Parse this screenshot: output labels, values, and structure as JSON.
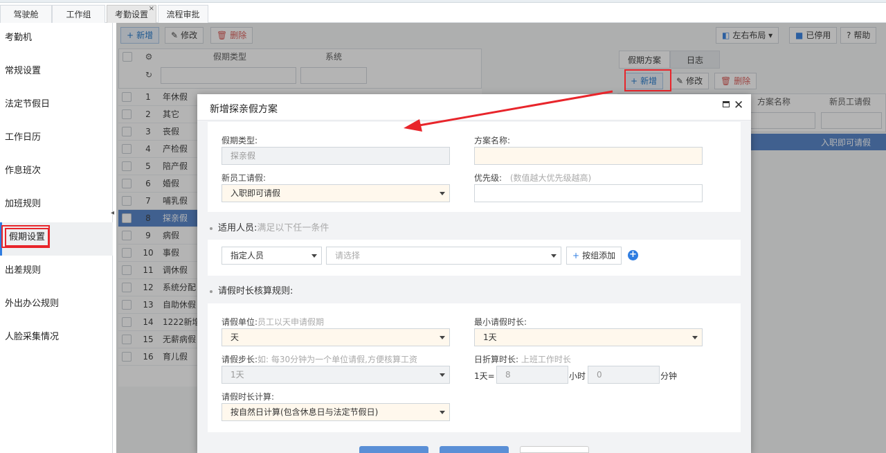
{
  "top_tabs": [
    {
      "label": "驾驶舱"
    },
    {
      "label": "工作组"
    },
    {
      "label": "考勤设置",
      "close": "×"
    },
    {
      "label": "流程审批"
    }
  ],
  "sidebar": {
    "items": [
      {
        "label": "考勤机"
      },
      {
        "label": "常规设置"
      },
      {
        "label": "法定节假日"
      },
      {
        "label": "工作日历"
      },
      {
        "label": "作息班次"
      },
      {
        "label": "加班规则"
      },
      {
        "label": "假期设置"
      },
      {
        "label": "出差规则"
      },
      {
        "label": "外出办公规则"
      },
      {
        "label": "人脸采集情况"
      }
    ],
    "toggle": "◂"
  },
  "toolbar": {
    "add": "新增",
    "edit": "修改",
    "delete": "删除",
    "layout": "左右布局",
    "disabled": "已停用",
    "help": "帮助"
  },
  "grid": {
    "columns": {
      "type": "假期类型",
      "system": "系统"
    },
    "rows": [
      {
        "no": "1",
        "name": "年休假"
      },
      {
        "no": "2",
        "name": "其它"
      },
      {
        "no": "3",
        "name": "丧假"
      },
      {
        "no": "4",
        "name": "产检假"
      },
      {
        "no": "5",
        "name": "陪产假"
      },
      {
        "no": "6",
        "name": "婚假"
      },
      {
        "no": "7",
        "name": "哺乳假"
      },
      {
        "no": "8",
        "name": "探亲假"
      },
      {
        "no": "9",
        "name": "病假"
      },
      {
        "no": "10",
        "name": "事假"
      },
      {
        "no": "11",
        "name": "调休假"
      },
      {
        "no": "12",
        "name": "系统分配"
      },
      {
        "no": "13",
        "name": "自助休假"
      },
      {
        "no": "14",
        "name": "1222新增"
      },
      {
        "no": "15",
        "name": "无薪病假"
      },
      {
        "no": "16",
        "name": "育儿假"
      }
    ]
  },
  "right_panel": {
    "tabs": [
      {
        "label": "假期方案"
      },
      {
        "label": "日志"
      }
    ],
    "add": "新增",
    "edit": "修改",
    "delete": "删除",
    "col_plan_name": "方案名称",
    "col_new_staff": "新员工请假",
    "selected_value": "入职即可请假"
  },
  "modal": {
    "title": "新增探亲假方案",
    "leave_type_label": "假期类型:",
    "leave_type_value": "探亲假",
    "plan_name_label": "方案名称:",
    "plan_name_value": "",
    "new_staff_label": "新员工请假:",
    "new_staff_value": "入职即可请假",
    "priority_label": "优先级:",
    "priority_hint": "(数值越大优先级越高)",
    "priority_value": "",
    "applicable_title": "适用人员:",
    "applicable_hint": "满足以下任一条件",
    "person_select": "指定人员",
    "person_placeholder": "请选择",
    "group_add": "按组添加",
    "rules_title": "请假时长核算规则:",
    "unit_label": "请假单位:",
    "unit_hint": "员工以天申请假期",
    "unit_value": "天",
    "min_label": "最小请假时长:",
    "min_value": "1天",
    "step_label": "请假步长:",
    "step_hint": "如: 每30分钟为一个单位请假,方便核算工资",
    "step_value": "1天",
    "daily_label": "日折算时长:",
    "daily_hint": "上班工作时长",
    "day_prefix": "1天=",
    "hours_value": "8",
    "hours_unit": "小时",
    "minutes_value": "0",
    "minutes_unit": "分钟",
    "calc_label": "请假时长计算:",
    "calc_value": "按自然日计算(包含休息日与法定节假日)"
  },
  "colors": {
    "accent": "#2f7de1",
    "annotation": "#e8252b",
    "selected_row": "#4d7fc7"
  }
}
